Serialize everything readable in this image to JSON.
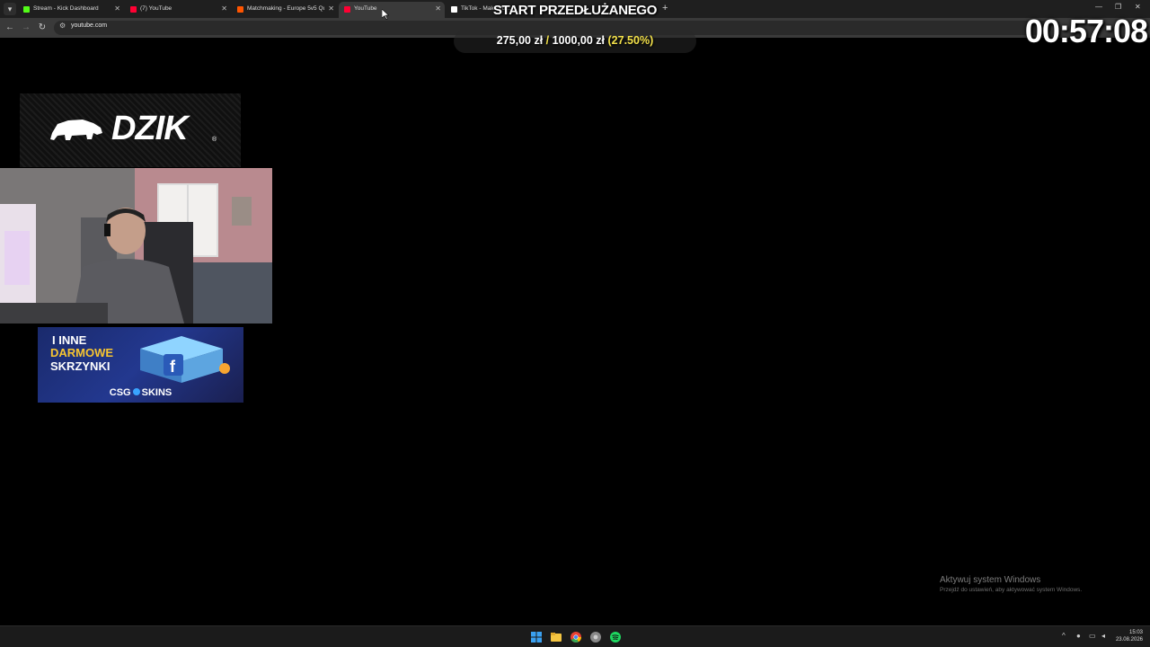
{
  "browser": {
    "tabs": [
      {
        "label": "Stream - Kick Dashboard",
        "favicon_color": "#53fc18",
        "active": false
      },
      {
        "label": "(7) YouTube",
        "favicon_color": "#ff0033",
        "active": false
      },
      {
        "label": "Matchmaking - Europe 5v5 Qu...",
        "favicon_color": "#ff5500",
        "active": false
      },
      {
        "label": "YouTube",
        "favicon_color": "#ff0033",
        "active": true
      },
      {
        "label": "TikTok - Make Yo...",
        "favicon_color": "#ffffff",
        "active": false
      }
    ],
    "url": "youtube.com"
  },
  "overlay": {
    "goal_title": "START PRZEDŁUŻANEGO",
    "goal_current": "275,00 zł",
    "goal_separator": "/",
    "goal_target": "1000,00 zł",
    "goal_percent": "(27.50%)",
    "goal_progress": 0.275,
    "timer": "00:57:08",
    "sponsor_logo": "DZIK",
    "banner_line1": "I INNE",
    "banner_line2": "DARMOWE",
    "banner_line3": "SKRZYNKI",
    "banner_brand_left": "CSG",
    "banner_brand_right": "SKINS"
  },
  "windows": {
    "activation_title": "Aktywuj system Windows",
    "activation_subtitle": "Przejdź do ustawień, aby aktywować system Windows.",
    "clock_time": "15:03",
    "clock_date": "23.08.2026"
  },
  "colors": {
    "goal_percent": "#f2e04a",
    "banner_accent": "#f7c531"
  }
}
